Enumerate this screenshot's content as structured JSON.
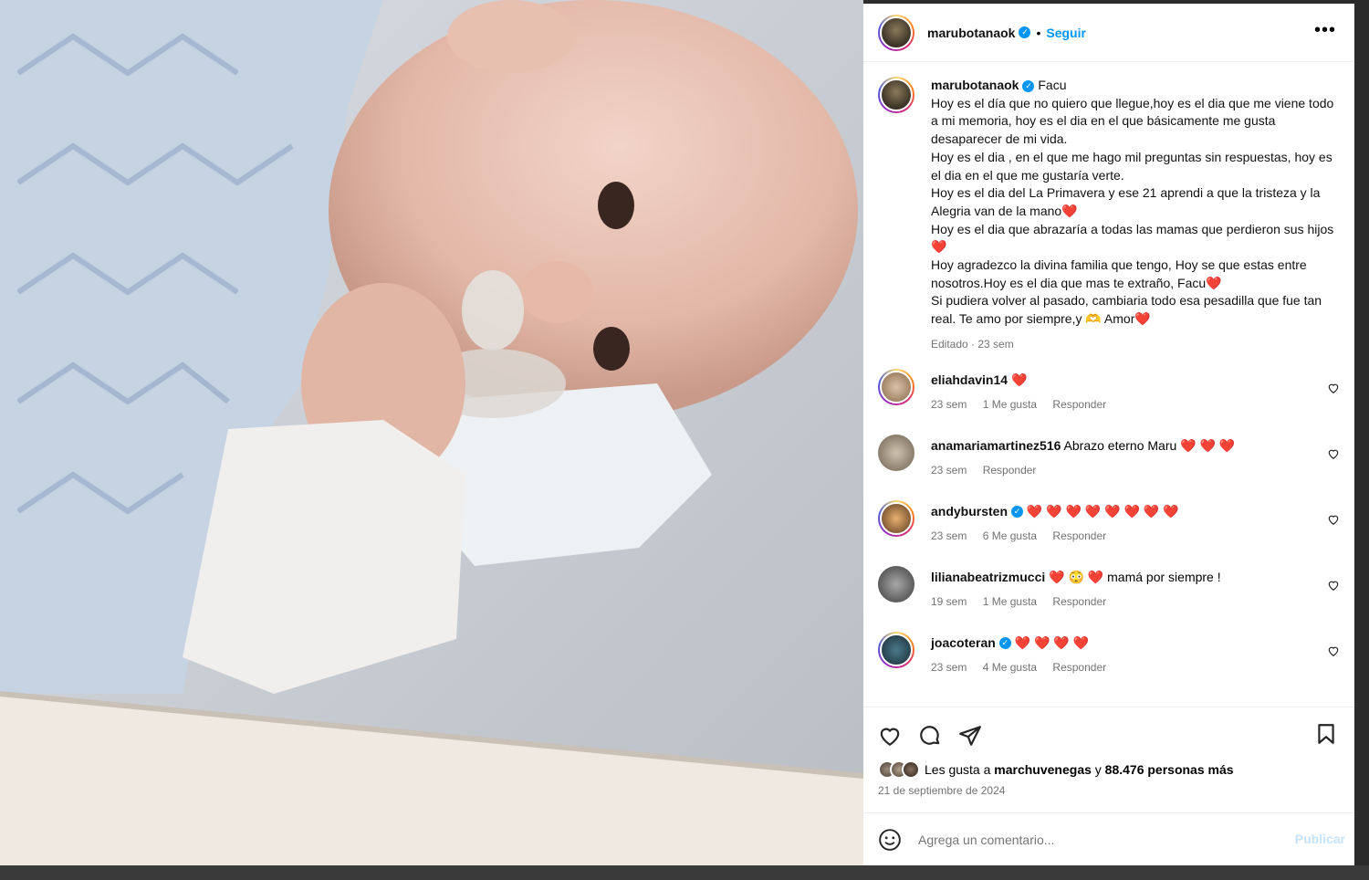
{
  "post": {
    "username": "marubotanaok",
    "follow": "Seguir",
    "more": "•••"
  },
  "caption": {
    "username": "marubotanaok",
    "lines": [
      "Facu",
      "Hoy es el día que no quiero que llegue,hoy es el dia que me viene todo a mi memoria, hoy es el dia en el que básicamente me gusta desaparecer de mi vida.",
      "Hoy es el dia , en el que me hago mil preguntas sin respuestas, hoy es el dia en el que me gustaría verte.",
      "Hoy es el dia del La Primavera y ese 21 aprendi a que la tristeza y la Alegria van de la mano❤️",
      "Hoy es el dia que abrazaría a todas las mamas que perdieron sus hijos❤️",
      "Hoy agradezco la divina familia que tengo, Hoy se que estas entre nosotros.Hoy es el dia que mas te extraño, Facu❤️",
      "Si pudiera volver al pasado, cambiaria todo esa pesadilla que fue tan real. Te amo por siempre,y 🫶 Amor❤️"
    ],
    "meta": "Editado · 23 sem"
  },
  "comments": [
    {
      "user": "eliahdavin14",
      "text": "❤️",
      "time": "23 sem",
      "likes": "1 Me gusta",
      "reply": "Responder"
    },
    {
      "user": "anamariamartinez516",
      "text": "Abrazo eterno Maru ❤️ ❤️ ❤️",
      "time": "23 sem",
      "likes": "",
      "reply": "Responder"
    },
    {
      "user": "andybursten",
      "text": "❤️ ❤️ ❤️ ❤️ ❤️ ❤️ ❤️ ❤️",
      "time": "23 sem",
      "likes": "6 Me gusta",
      "reply": "Responder"
    },
    {
      "user": "lilianabeatrizmucci",
      "text": "❤️ 😳 ❤️  mamá por siempre !",
      "time": "19 sem",
      "likes": "1 Me gusta",
      "reply": "Responder"
    },
    {
      "user": "joacoteran",
      "text": "❤️ ❤️ ❤️ ❤️",
      "time": "23 sem",
      "likes": "4 Me gusta",
      "reply": "Responder"
    }
  ],
  "likes": {
    "prefix": "Les gusta a ",
    "user": "marchuvenegas",
    "middle": " y ",
    "count": "88.476 personas más"
  },
  "date": "21 de septiembre de 2024",
  "add_comment": {
    "placeholder": "Agrega un comentario...",
    "publish": "Publicar"
  },
  "colors": {
    "accent": "#0095f6",
    "heart": "#e0212f"
  }
}
